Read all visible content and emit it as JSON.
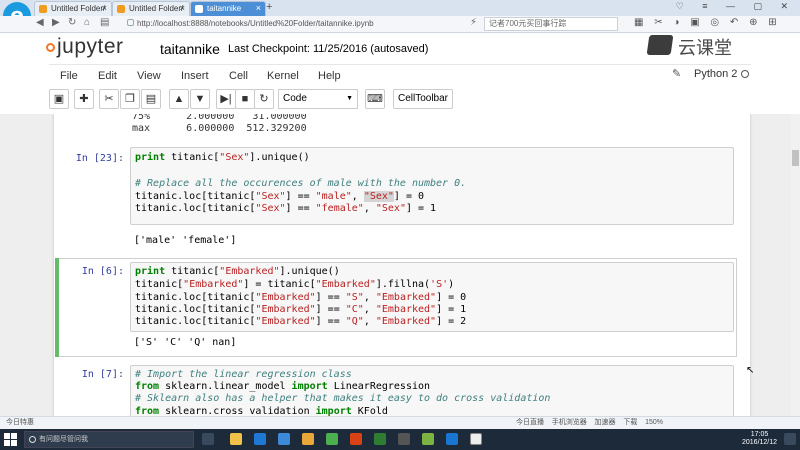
{
  "browser": {
    "tabs": [
      {
        "label": "Untitled Folder/",
        "close": "×"
      },
      {
        "label": "Untitled Folder/",
        "close": "×"
      },
      {
        "label": "taitannike",
        "close": "×"
      }
    ],
    "new_tab": "+",
    "url": "http://localhost:8888/notebooks/Untitled%20Folder/taitannike.ipynb",
    "search_placeholder": "记者700元买回事行踪",
    "status_left": "今日特惠",
    "status_right": "今日直播    手机浏览器    加速器    下载    150%",
    "colors": {
      "tabbar": "#d9e3ef",
      "active_tab": "#4d8fd6",
      "logo": "#1a9be0"
    }
  },
  "jupyter": {
    "logo_text": "jupyter",
    "notebook_name": "taitannike",
    "checkpoint": "Last Checkpoint: 11/25/2016 (autosaved)",
    "brand_watermark": "云课堂",
    "menu": [
      "File",
      "Edit",
      "View",
      "Insert",
      "Cell",
      "Kernel",
      "Help"
    ],
    "kernel": "Python 2",
    "toolbar": {
      "icons": [
        "save-icon",
        "plus-icon",
        "cut-icon",
        "copy-icon",
        "paste-icon",
        "arrow-up-icon",
        "arrow-down-icon",
        "skip-to-end-icon",
        "stop-icon",
        "refresh-icon"
      ],
      "cell_type": "Code",
      "cell_toolbar": "CellToolbar"
    },
    "colors": {
      "orange": "#f37726",
      "prompt": "#303f9f",
      "selected_bar": "#66bb6a"
    }
  },
  "cells": {
    "prev_output": [
      "75%      2.000000   31.000000",
      "max      6.000000  512.329200"
    ],
    "cell1": {
      "prompt": "In [23]:",
      "line1_kw": "print",
      "line1_a": " titanic[",
      "line1_s": "\"Sex\"",
      "line1_b": "].unique()",
      "comment": "# Replace all the occurences of male with the number 0.",
      "line3_a": "titanic.loc[titanic[",
      "line3_s1": "\"Sex\"",
      "line3_b": "] == ",
      "line3_s2": "\"male\"",
      "line3_c": ", ",
      "line3_s3": "\"Sex\"",
      "line3_d": "] = 0",
      "line4_a": "titanic.loc[titanic[",
      "line4_s1": "\"Sex\"",
      "line4_b": "] == ",
      "line4_s2": "\"female\"",
      "line4_c": ", ",
      "line4_s3": "\"Sex\"",
      "line4_d": "] = 1",
      "output": "['male' 'female']"
    },
    "cell2": {
      "prompt": "In [6]:",
      "l1_kw": "print",
      "l1_a": " titanic[",
      "l1_s": "\"Embarked\"",
      "l1_b": "].unique()",
      "l2_a": "titanic[",
      "l2_s1": "\"Embarked\"",
      "l2_b": "] = titanic[",
      "l2_s2": "\"Embarked\"",
      "l2_c": "].fillna(",
      "l2_s3": "'S'",
      "l2_d": ")",
      "l3_a": "titanic.loc[titanic[",
      "l3_s1": "\"Embarked\"",
      "l3_b": "] == ",
      "l3_s2": "\"S\"",
      "l3_c": ", ",
      "l3_s3": "\"Embarked\"",
      "l3_d": "] = 0",
      "l4_s2": "\"C\"",
      "l4_d": "] = 1",
      "l5_s2": "\"Q\"",
      "l5_d": "] = 2",
      "output": "['S' 'C' 'Q' nan]"
    },
    "cell3": {
      "prompt": "In [7]:",
      "c1": "# Import the linear regression class",
      "i1_kw": "from",
      "i1_a": " sklearn.linear_model ",
      "i1_kw2": "import",
      "i1_b": " LinearRegression",
      "c2": "# Sklearn also has a helper that makes it easy to do cross validation",
      "i2_kw": "from",
      "i2_a": " sklearn.cross_validation ",
      "i2_kw2": "import",
      "i2_b": " KFold"
    }
  },
  "taskbar": {
    "search_placeholder": "有问题尽管问我",
    "time": "17:05",
    "date": "2016/12/12"
  }
}
